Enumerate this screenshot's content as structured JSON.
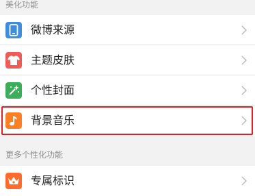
{
  "sections": [
    {
      "header": "美化功能",
      "items": [
        {
          "label": "微博来源",
          "icon": "phone-icon",
          "color": "#3f8ddd"
        },
        {
          "label": "主题皮肤",
          "icon": "shirt-icon",
          "color": "#ef5b56"
        },
        {
          "label": "个性封面",
          "icon": "magic-wand-icon",
          "color": "#3cae5b"
        },
        {
          "label": "背景音乐",
          "icon": "music-note-icon",
          "color": "#ff7f24",
          "highlighted": true
        }
      ]
    },
    {
      "header": "更多个性化功能",
      "items": [
        {
          "label": "专属标识",
          "icon": "crown-badge-icon",
          "color": "#ff6a2d"
        }
      ]
    }
  ]
}
